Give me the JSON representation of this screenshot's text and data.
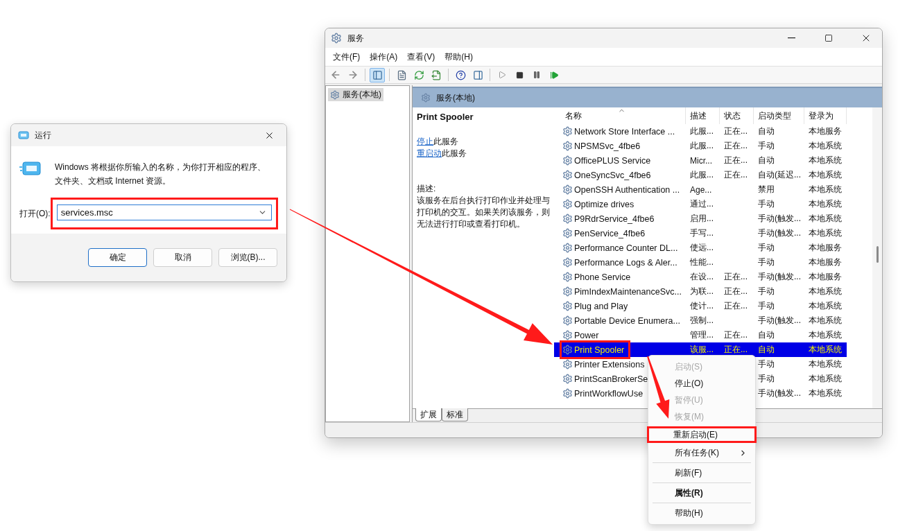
{
  "run_dialog": {
    "title": "运行",
    "message": "Windows 将根据你所输入的名称，为你打开相应的程序、文件夹、文档或 Internet 资源。",
    "open_label": "打开(O):",
    "input": {
      "value": "services.msc",
      "highlighted": true
    },
    "buttons": [
      {
        "label": "确定",
        "default": true
      },
      {
        "label": "取消",
        "default": false
      },
      {
        "label": "浏览(B)...",
        "default": false
      }
    ]
  },
  "services_window": {
    "title": "服务",
    "menu": [
      "文件(F)",
      "操作(A)",
      "查看(V)",
      "帮助(H)"
    ],
    "toolbar": {
      "console_tree_shown": true
    },
    "tree": [
      {
        "label": "服务(本地)",
        "selected": true
      }
    ],
    "pane_title": "服务(本地)",
    "details": {
      "service_name": "Print Spooler",
      "actions": [
        {
          "link": "停止",
          "text": "此服务"
        },
        {
          "link": "重启动",
          "text": "此服务"
        }
      ],
      "description_label": "描述:",
      "description": "该服务在后台执行打印作业并处理与打印机的交互。如果关闭该服务，则无法进行打印或查看打印机。"
    },
    "columns": [
      {
        "label": "名称",
        "sorted": true
      },
      {
        "label": "描述",
        "sorted": false
      },
      {
        "label": "状态",
        "sorted": false
      },
      {
        "label": "启动类型",
        "sorted": false
      },
      {
        "label": "登录为",
        "sorted": false
      }
    ],
    "rows": [
      {
        "name": "Network Store Interface ...",
        "description": "此服...",
        "status": "正在...",
        "startup": "自动",
        "logon": "本地服务",
        "selected": false,
        "highlighted": false
      },
      {
        "name": "NPSMSvc_4fbe6",
        "description": "此服...",
        "status": "正在...",
        "startup": "手动",
        "logon": "本地系统",
        "selected": false,
        "highlighted": false
      },
      {
        "name": "OfficePLUS Service",
        "description": "Micr...",
        "status": "正在...",
        "startup": "自动",
        "logon": "本地系统",
        "selected": false,
        "highlighted": false
      },
      {
        "name": "OneSyncSvc_4fbe6",
        "description": "此服...",
        "status": "正在...",
        "startup": "自动(延迟...",
        "logon": "本地系统",
        "selected": false,
        "highlighted": false
      },
      {
        "name": "OpenSSH Authentication ...",
        "description": "Age...",
        "startup": "禁用",
        "logon": "本地系统",
        "selected": false,
        "highlighted": false
      },
      {
        "name": "Optimize drives",
        "description": "通过...",
        "startup": "手动",
        "logon": "本地系统",
        "selected": false,
        "highlighted": false
      },
      {
        "name": "P9RdrService_4fbe6",
        "description": "启用...",
        "startup": "手动(触发...",
        "logon": "本地系统",
        "selected": false,
        "highlighted": false
      },
      {
        "name": "PenService_4fbe6",
        "description": "手写...",
        "startup": "手动(触发...",
        "logon": "本地系统",
        "selected": false,
        "highlighted": false
      },
      {
        "name": "Performance Counter DL...",
        "description": "使远...",
        "startup": "手动",
        "logon": "本地服务",
        "selected": false,
        "highlighted": false
      },
      {
        "name": "Performance Logs & Aler...",
        "description": "性能...",
        "startup": "手动",
        "logon": "本地服务",
        "selected": false,
        "highlighted": false
      },
      {
        "name": "Phone Service",
        "description": "在设...",
        "status": "正在...",
        "startup": "手动(触发...",
        "logon": "本地服务",
        "selected": false,
        "highlighted": false
      },
      {
        "name": "PimIndexMaintenanceSvc...",
        "description": "为联...",
        "status": "正在...",
        "startup": "手动",
        "logon": "本地系统",
        "selected": false,
        "highlighted": false
      },
      {
        "name": "Plug and Play",
        "description": "使计...",
        "status": "正在...",
        "startup": "手动",
        "logon": "本地系统",
        "selected": false,
        "highlighted": false
      },
      {
        "name": "Portable Device Enumera...",
        "description": "强制...",
        "startup": "手动(触发...",
        "logon": "本地系统",
        "selected": false,
        "highlighted": false
      },
      {
        "name": "Power",
        "description": "管理...",
        "status": "正在...",
        "startup": "自动",
        "logon": "本地系统",
        "selected": false,
        "highlighted": false
      },
      {
        "name": "Print Spooler",
        "description": "该服...",
        "status": "正在...",
        "startup": "自动",
        "logon": "本地系统",
        "selected": true,
        "highlighted": true
      },
      {
        "name": "Printer Extensions",
        "startup": "手动",
        "logon": "本地系统",
        "selected": false,
        "highlighted": false
      },
      {
        "name": "PrintScanBrokerSe",
        "startup": "手动",
        "logon": "本地系统",
        "selected": false,
        "highlighted": false
      },
      {
        "name": "PrintWorkflowUse",
        "startup": "手动(触发...",
        "logon": "本地系统",
        "selected": false,
        "highlighted": false
      }
    ],
    "tabs": [
      {
        "label": "扩展",
        "selected": true
      },
      {
        "label": "标准",
        "selected": false
      }
    ]
  },
  "context_menu": {
    "items": [
      {
        "kind": "item",
        "label": "启动(S)",
        "disabled": true,
        "bold": false,
        "submenu": false,
        "highlighted": false
      },
      {
        "kind": "item",
        "label": "停止(O)",
        "disabled": false,
        "bold": false,
        "submenu": false,
        "highlighted": false
      },
      {
        "kind": "item",
        "label": "暂停(U)",
        "disabled": true,
        "bold": false,
        "submenu": false,
        "highlighted": false
      },
      {
        "kind": "item",
        "label": "恢复(M)",
        "disabled": true,
        "bold": false,
        "submenu": false,
        "highlighted": false
      },
      {
        "kind": "item",
        "label": "重新启动(E)",
        "disabled": false,
        "bold": false,
        "submenu": false,
        "highlighted": true
      },
      {
        "kind": "item",
        "label": "所有任务(K)",
        "disabled": false,
        "bold": false,
        "submenu": true,
        "highlighted": false
      },
      {
        "kind": "separator"
      },
      {
        "kind": "item",
        "label": "刷新(F)",
        "disabled": false,
        "bold": false,
        "submenu": false,
        "highlighted": false
      },
      {
        "kind": "separator"
      },
      {
        "kind": "item",
        "label": "属性(R)",
        "disabled": false,
        "bold": true,
        "submenu": false,
        "highlighted": false
      },
      {
        "kind": "separator"
      },
      {
        "kind": "item",
        "label": "帮助(H)",
        "disabled": false,
        "bold": false,
        "submenu": false,
        "highlighted": false
      }
    ]
  }
}
